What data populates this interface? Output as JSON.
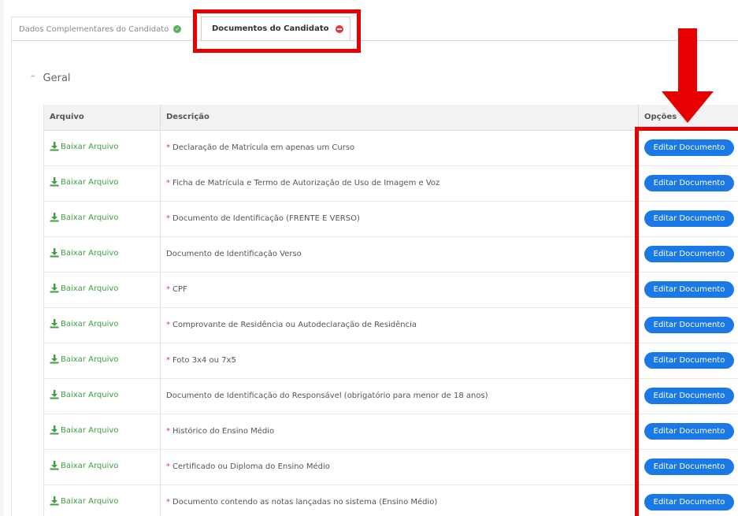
{
  "tabs": [
    {
      "label": "Dados Complementares do Candidato",
      "status": "complete"
    },
    {
      "label": "Documentos do Candidato",
      "status": "incomplete"
    }
  ],
  "section": {
    "title": "Geral"
  },
  "table": {
    "headers": {
      "file": "Arquivo",
      "description": "Descrição",
      "options": "Opções"
    },
    "download_label": "Baixar Arquivo",
    "edit_label": "Editar Documento",
    "rows": [
      {
        "required": true,
        "description": "Declaração de Matrícula em apenas um Curso"
      },
      {
        "required": true,
        "description": "Ficha de Matrícula e Termo de Autorização de Uso de Imagem e Voz"
      },
      {
        "required": true,
        "description": "Documento de Identificação (FRENTE E VERSO)"
      },
      {
        "required": false,
        "description": "Documento de Identificação Verso"
      },
      {
        "required": true,
        "description": "CPF"
      },
      {
        "required": true,
        "description": "Comprovante de Residência ou Autodeclaração de Residência"
      },
      {
        "required": true,
        "description": "Foto 3x4 ou 7x5"
      },
      {
        "required": false,
        "description": "Documento de Identificação do Responsável (obrigatório para menor de 18 anos)"
      },
      {
        "required": true,
        "description": "Histórico do Ensino Médio"
      },
      {
        "required": true,
        "description": "Certificado ou Diploma do Ensino Médio"
      },
      {
        "required": true,
        "description": "Documento contendo as notas lançadas no sistema (Ensino Médio)"
      }
    ]
  },
  "colors": {
    "accent": "#1b79e6",
    "download": "#3f9e41",
    "highlight": "#e80000",
    "required": "#e53935"
  }
}
